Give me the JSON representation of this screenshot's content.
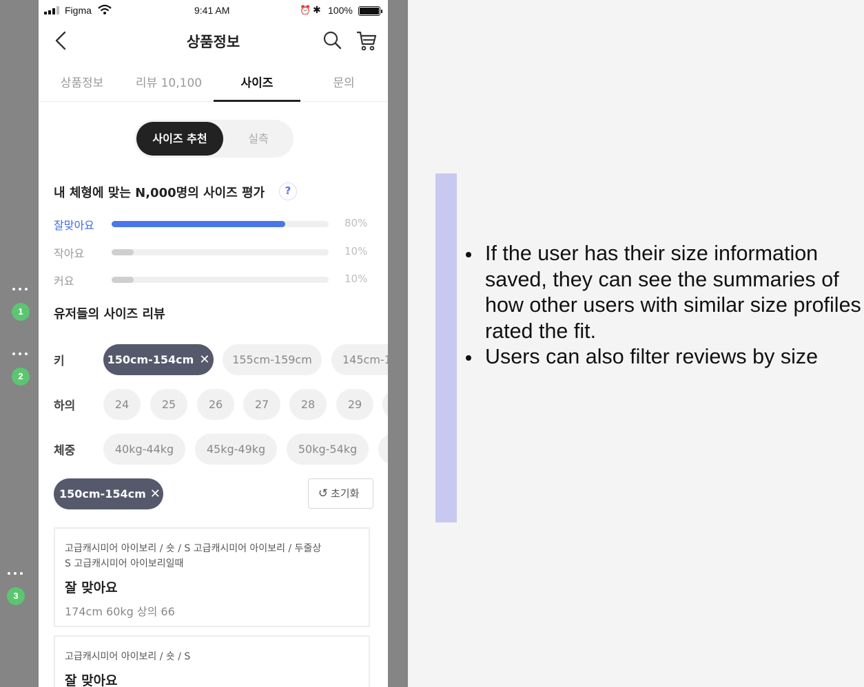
{
  "status_bar": {
    "carrier": "Figma",
    "time": "9:41 AM",
    "battery": "100%"
  },
  "header": {
    "title": "상품정보"
  },
  "tabs": [
    "상품정보",
    "리뷰 10,100",
    "사이즈",
    "문의"
  ],
  "size_toggle": {
    "active": "사이즈 추천",
    "inactive": "실측"
  },
  "fit_summary": {
    "title": "내 체형에 맞는 N,000명의 사이즈 평가",
    "help": "?",
    "rows": [
      {
        "label": "잘맞아요",
        "percent": "80%",
        "value": 0.8
      },
      {
        "label": "작아요",
        "percent": "10%",
        "value": 0.1
      },
      {
        "label": "커요",
        "percent": "10%",
        "value": 0.1
      }
    ]
  },
  "reviews_section": {
    "title": "유저들의 사이즈 리뷰"
  },
  "filters": {
    "height": {
      "label": "키",
      "chips": [
        "150cm-154cm",
        "155cm-159cm",
        "145cm-1"
      ],
      "selected_index": 0
    },
    "top_size": {
      "label": "하의",
      "chips": [
        "24",
        "25",
        "26",
        "27",
        "28",
        "29",
        ""
      ]
    },
    "weight": {
      "label": "체중",
      "chips": [
        "40kg-44kg",
        "45kg-49kg",
        "50kg-54kg",
        ""
      ]
    },
    "close_glyph": "✕"
  },
  "active_filter": {
    "label": "150cm-154cm"
  },
  "reset": {
    "label": "초기화"
  },
  "reviews": [
    {
      "option_line1": "고급캐시미어 아이보리 / 숏 / S 고급캐시미어 아이보리 / 두줄상",
      "option_line2": "S 고급캐시미어 아이보리일때",
      "verdict": "잘 맞아요",
      "body": "174cm  60kg 상의 66"
    },
    {
      "option_line1": "고급캐시미어 아이보리 / 숏 / S",
      "verdict": "잘 맞아요"
    }
  ],
  "markers": [
    "1",
    "2",
    "3"
  ],
  "annotation": {
    "bullets": [
      "If the user has their size information saved, they can see the summaries of how other users with similar size profiles rated the fit.",
      "Users can also filter reviews by size"
    ],
    "accent_color": "#c8c9f0"
  },
  "colors": {
    "primary_blue": "#4a76ea",
    "chip_selected": "#55596b",
    "marker_green": "#5cc571"
  }
}
